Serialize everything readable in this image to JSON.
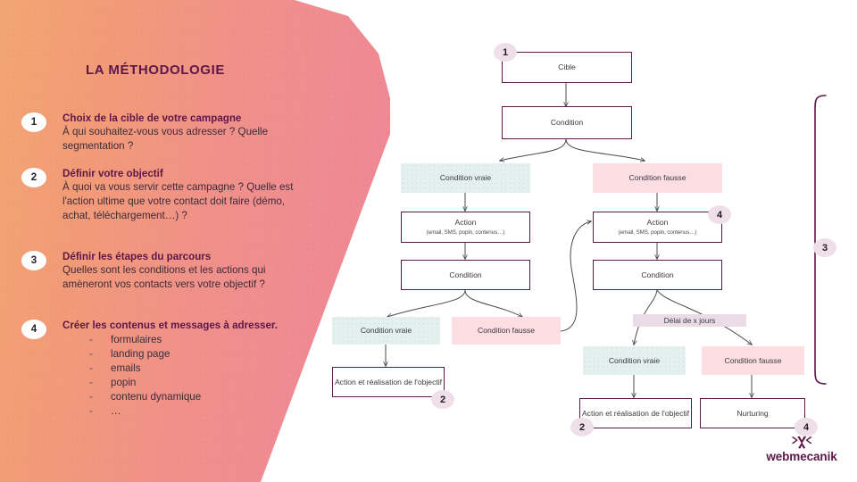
{
  "panel": {
    "title": "LA MÉTHODOLOGIE",
    "steps": [
      {
        "number": "1",
        "title": "Choix de la cible de votre campagne",
        "text": "À qui souhaitez-vous vous adresser ? Quelle segmentation ?"
      },
      {
        "number": "2",
        "title": "Définir votre objectif",
        "text": "À quoi va vous servir cette campagne ? Quelle est l'action ultime que votre contact doit faire (démo, achat, téléchargement…) ?"
      },
      {
        "number": "3",
        "title": "Définir les étapes du parcours",
        "text": "Quelles sont les conditions et les actions qui amèneront vos contacts vers votre objectif ?"
      },
      {
        "number": "4",
        "title": "Créer les contenus et messages à adresser.",
        "text": "",
        "bullets": [
          "formulaires",
          "landing page",
          "emails",
          "popin",
          "contenu dynamique",
          "…"
        ],
        "dash": "-"
      }
    ]
  },
  "flow": {
    "nodes": {
      "cible": "Cible",
      "condition_1": "Condition",
      "cond_vraie_1": "Condition vraie",
      "cond_fausse_1": "Condition fausse",
      "action_left": "Action",
      "action_left_sub": "(email, SMS, popin, contenus…)",
      "condition_left_2": "Condition",
      "cond_vraie_2": "Condition vraie",
      "cond_fausse_2": "Condition fausse",
      "objectif_left": "Action et réalisation de l'objectif",
      "action_right": "Action",
      "action_right_sub": "(email, SMS, popin, contenus…)",
      "condition_right_2": "Condition",
      "delai": "Délai de x jours",
      "cond_vraie_3": "Condition vraie",
      "cond_fausse_3": "Condition fausse",
      "objectif_right": "Action et réalisation de l'objectif",
      "nurturing": "Nurturing"
    },
    "badges": {
      "b1": "1",
      "b2_left": "2",
      "b2_right": "2",
      "b3_bracket": "3",
      "b4_action": "4",
      "b4_nurturing": "4"
    }
  },
  "logo": {
    "word": "webmecanik",
    "mark": "x-butterfly-icon"
  },
  "colors": {
    "brand_purple": "#5d1749",
    "gradient_left": "#f3a573",
    "gradient_right": "#ee8596",
    "true_green": "#e3f0ed",
    "false_pink": "#fbdde2",
    "delay_lavender": "#e9dce6",
    "badge_pink": "#efdfe9"
  }
}
